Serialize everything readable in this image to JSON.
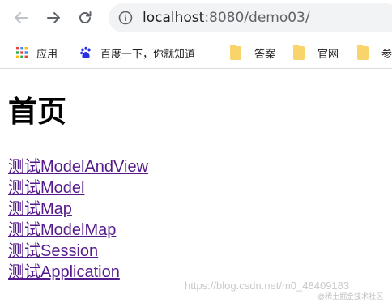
{
  "browser": {
    "url_host": "localhost",
    "url_rest": ":8080/demo03/"
  },
  "bookmarks": [
    {
      "label": "应用",
      "icon": "apps-grid-icon"
    },
    {
      "label": "百度一下，你就知道",
      "icon": "baidu-paw-icon"
    },
    {
      "label": "答案",
      "icon": "folder-icon"
    },
    {
      "label": "官网",
      "icon": "folder-icon"
    },
    {
      "label": "参",
      "icon": "folder-icon"
    }
  ],
  "page": {
    "heading": "首页",
    "links": [
      "测试ModelAndView",
      "测试Model",
      "测试Map",
      "测试ModelMap",
      "测试Session",
      "测试Application"
    ]
  },
  "watermark": {
    "text": "https://blog.csdn.net/m0_48409183",
    "secondary": "@稀土掘金技术社区"
  },
  "colors": {
    "link_visited": "#551a8b",
    "address_bar_bg": "#f1f3f4",
    "folder": "#f9d46b"
  }
}
